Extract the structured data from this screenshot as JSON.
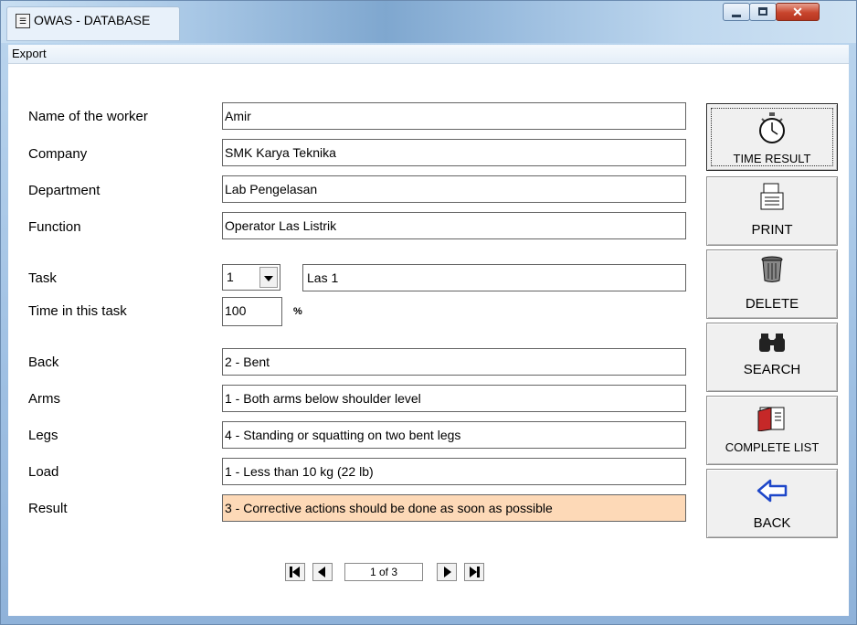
{
  "window": {
    "title": "OWAS - DATABASE",
    "app_icon": "form-icon"
  },
  "menu": {
    "export": "Export"
  },
  "form": {
    "name_label": "Name of the worker",
    "name_value": "Amir",
    "company_label": "Company",
    "company_value": "SMK Karya Teknika",
    "department_label": "Department",
    "department_value": "Lab Pengelasan",
    "function_label": "Function",
    "function_value": "Operator Las Listrik",
    "task_label": "Task",
    "task_number": "1",
    "task_name": "Las 1",
    "time_label": "Time in this task",
    "time_value": "100",
    "time_unit": "%",
    "back_label": "Back",
    "back_value": "2 - Bent",
    "arms_label": "Arms",
    "arms_value": "1 - Both arms below shoulder level",
    "legs_label": "Legs",
    "legs_value": "4 - Standing or squatting on two bent legs",
    "load_label": "Load",
    "load_value": "1 - Less than 10 kg (22 lb)",
    "result_label": "Result",
    "result_value": "3 - Corrective actions should be done as soon as possible",
    "result_color": "#fdd9b7"
  },
  "buttons": {
    "time_result": "TIME RESULT",
    "print": "PRINT",
    "delete": "DELETE",
    "search": "SEARCH",
    "complete_list": "COMPLETE LIST",
    "back": "BACK"
  },
  "navigator": {
    "record": "1 of 3"
  }
}
